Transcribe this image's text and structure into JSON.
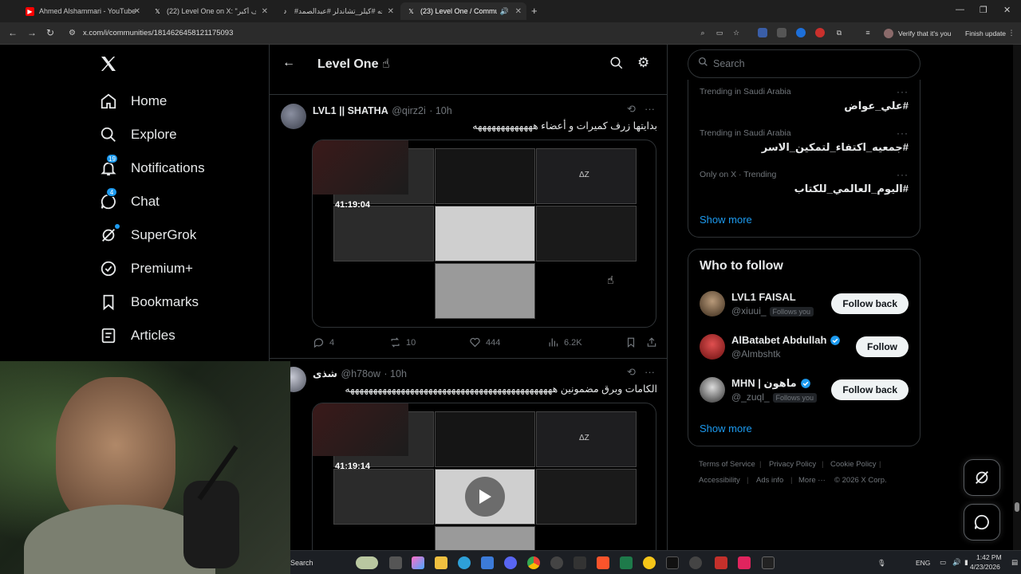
{
  "browser": {
    "tabs": [
      {
        "title": "Ahmed Alshammari - YouTube",
        "icon": "youtube-icon",
        "color": "#ff0000"
      },
      {
        "title": "(22) Level One on X: \"الهدف أكبر",
        "icon": "x-logo-icon",
        "color": "#ffffff"
      },
      {
        "title": "#مجه #كيلر_تشاندلر #عبدالصمد",
        "icon": "tiktok-icon",
        "color": "#ffffff"
      },
      {
        "title": "(23) Level One / Communi",
        "icon": "x-logo-icon",
        "color": "#ffffff"
      }
    ],
    "url": "x.com/i/communities/1814626458121175093",
    "profile_label": "Verify that it's you",
    "update_label": "Finish update"
  },
  "sidebar": {
    "items": [
      {
        "label": "Home",
        "icon": "home-icon"
      },
      {
        "label": "Explore",
        "icon": "search-icon"
      },
      {
        "label": "Notifications",
        "icon": "bell-icon",
        "badge": "19"
      },
      {
        "label": "Chat",
        "icon": "chat-icon",
        "badge": "4"
      },
      {
        "label": "SuperGrok",
        "icon": "grok-icon"
      },
      {
        "label": "Premium+",
        "icon": "verified-icon"
      },
      {
        "label": "Bookmarks",
        "icon": "bookmark-icon"
      },
      {
        "label": "Articles",
        "icon": "articles-icon"
      }
    ]
  },
  "feed": {
    "title": "Level One ☝",
    "tweets": [
      {
        "name": "LVL1 || SHATHA",
        "handle": "@qirz2i",
        "time": "· 10h",
        "text": "بدايتها زرف كميرات و أعضاء هههههههههههههه",
        "video_time": "41:19:04",
        "replies": "4",
        "reposts": "10",
        "likes": "444",
        "views": "6.2K"
      },
      {
        "name": "شذى",
        "handle": "@h78ow",
        "time": "· 10h",
        "text": "الكامات وبرق مضمونين هههههههههههههههههههههههههههههههههههههههههههههه",
        "video_time": "41:19:14"
      }
    ]
  },
  "right": {
    "search_placeholder": "Search",
    "trends": [
      {
        "meta": "Trending in Saudi Arabia",
        "name": "#علي_عواض"
      },
      {
        "meta": "Trending in Saudi Arabia",
        "name": "#جمعيه_اكتفاء_لتمكين_الاسر"
      },
      {
        "meta": "Only on X · Trending",
        "name": "#اليوم_العالمي_للكتاب"
      }
    ],
    "trends_show_more": "Show more",
    "who_to_follow": {
      "title": "Who to follow",
      "users": [
        {
          "name": "LVL1 FAISAL",
          "handle": "@xiuui_",
          "follows_you": "Follows you",
          "button": "Follow back"
        },
        {
          "name": "AlBatabet Abdullah",
          "handle": "@Almbshtk",
          "button": "Follow"
        },
        {
          "name": "MHN | ماهون",
          "handle": "@_zuql_",
          "follows_you": "Follows you",
          "button": "Follow back"
        }
      ],
      "show_more": "Show more"
    },
    "footer": [
      "Terms of Service",
      "Privacy Policy",
      "Cookie Policy",
      "Accessibility",
      "Ads info",
      "More ···",
      "© 2026 X Corp."
    ]
  },
  "taskbar": {
    "search_label": "Search",
    "lang": "ENG",
    "time": "1:42 PM",
    "date": "4/23/2026"
  },
  "colors": {
    "accent": "#1d9bf0",
    "background": "#000000",
    "border": "#2f3336"
  }
}
